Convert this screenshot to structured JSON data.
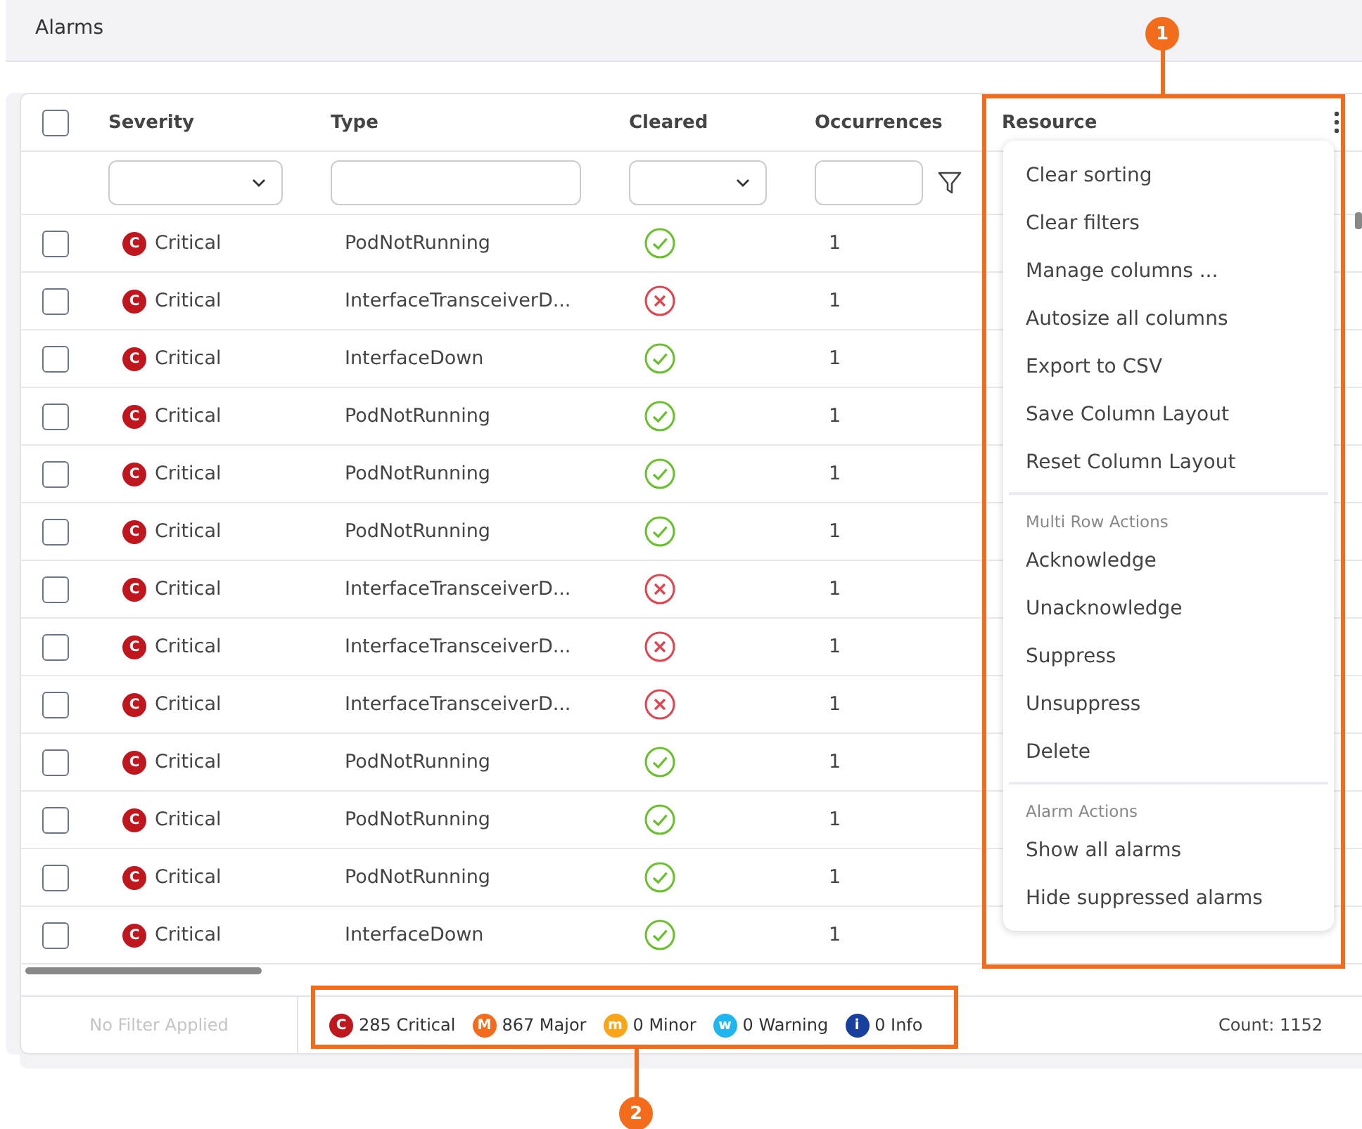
{
  "title": "Alarms",
  "table": {
    "all_checked": false,
    "columns": [
      {
        "label": "Severity",
        "kind": "select"
      },
      {
        "label": "Type",
        "kind": "text"
      },
      {
        "label": "Cleared",
        "kind": "select"
      },
      {
        "label": "Occurrences",
        "kind": "number"
      },
      {
        "label": "Resource",
        "kind": "plain"
      }
    ],
    "rows": [
      {
        "checked": false,
        "severity": {
          "kind": "critical",
          "badge": "C",
          "label": "Critical"
        },
        "type": "PodNotRunning",
        "cleared": true,
        "occurrences": "1"
      },
      {
        "checked": false,
        "severity": {
          "kind": "critical",
          "badge": "C",
          "label": "Critical"
        },
        "type": "InterfaceTransceiverD...",
        "cleared": false,
        "occurrences": "1"
      },
      {
        "checked": false,
        "severity": {
          "kind": "critical",
          "badge": "C",
          "label": "Critical"
        },
        "type": "InterfaceDown",
        "cleared": true,
        "occurrences": "1"
      },
      {
        "checked": false,
        "severity": {
          "kind": "critical",
          "badge": "C",
          "label": "Critical"
        },
        "type": "PodNotRunning",
        "cleared": true,
        "occurrences": "1"
      },
      {
        "checked": false,
        "severity": {
          "kind": "critical",
          "badge": "C",
          "label": "Critical"
        },
        "type": "PodNotRunning",
        "cleared": true,
        "occurrences": "1"
      },
      {
        "checked": false,
        "severity": {
          "kind": "critical",
          "badge": "C",
          "label": "Critical"
        },
        "type": "PodNotRunning",
        "cleared": true,
        "occurrences": "1"
      },
      {
        "checked": false,
        "severity": {
          "kind": "critical",
          "badge": "C",
          "label": "Critical"
        },
        "type": "InterfaceTransceiverD...",
        "cleared": false,
        "occurrences": "1"
      },
      {
        "checked": false,
        "severity": {
          "kind": "critical",
          "badge": "C",
          "label": "Critical"
        },
        "type": "InterfaceTransceiverD...",
        "cleared": false,
        "occurrences": "1"
      },
      {
        "checked": false,
        "severity": {
          "kind": "critical",
          "badge": "C",
          "label": "Critical"
        },
        "type": "InterfaceTransceiverD...",
        "cleared": false,
        "occurrences": "1"
      },
      {
        "checked": false,
        "severity": {
          "kind": "critical",
          "badge": "C",
          "label": "Critical"
        },
        "type": "PodNotRunning",
        "cleared": true,
        "occurrences": "1"
      },
      {
        "checked": false,
        "severity": {
          "kind": "critical",
          "badge": "C",
          "label": "Critical"
        },
        "type": "PodNotRunning",
        "cleared": true,
        "occurrences": "1"
      },
      {
        "checked": false,
        "severity": {
          "kind": "critical",
          "badge": "C",
          "label": "Critical"
        },
        "type": "PodNotRunning",
        "cleared": true,
        "occurrences": "1"
      },
      {
        "checked": false,
        "severity": {
          "kind": "critical",
          "badge": "C",
          "label": "Critical"
        },
        "type": "InterfaceDown",
        "cleared": true,
        "occurrences": "1"
      }
    ]
  },
  "column_menu": {
    "groups": [
      {
        "items": [
          "Clear sorting",
          "Clear filters",
          "Manage columns ...",
          "Autosize all columns",
          "Export to CSV",
          "Save Column Layout",
          "Reset Column Layout"
        ]
      },
      {
        "heading": "Multi Row Actions",
        "items": [
          "Acknowledge",
          "Unacknowledge",
          "Suppress",
          "Unsuppress",
          "Delete"
        ]
      },
      {
        "heading": "Alarm Actions",
        "items": [
          "Show all alarms",
          "Hide suppressed alarms"
        ]
      }
    ]
  },
  "footer": {
    "filter_status": "No Filter Applied",
    "summary": [
      {
        "badge": "C",
        "text": "285 Critical",
        "color": "#c0161e"
      },
      {
        "badge": "M",
        "text": "867 Major",
        "color": "#f26c1c"
      },
      {
        "badge": "m",
        "text": "0 Minor",
        "color": "#f9a51a"
      },
      {
        "badge": "w",
        "text": "0 Warning",
        "color": "#1fb6f0"
      },
      {
        "badge": "i",
        "text": "0 Info",
        "color": "#173f9e"
      }
    ],
    "count": "Count: 1152"
  },
  "annotations": [
    {
      "number": "1"
    },
    {
      "number": "2"
    }
  ]
}
